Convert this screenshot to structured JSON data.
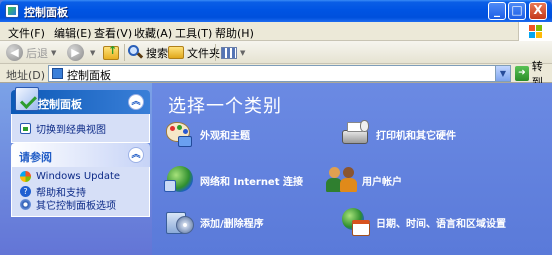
{
  "window": {
    "title": "控制面板",
    "buttons": {
      "minimize": "_",
      "maximize": "□",
      "close": "X"
    }
  },
  "menu": [
    "文件(F)",
    "编辑(E)",
    "查看(V)",
    "收藏(A)",
    "工具(T)",
    "帮助(H)"
  ],
  "toolbar": {
    "back": "后退",
    "search": "搜索",
    "folders": "文件夹"
  },
  "address": {
    "label": "地址(D)",
    "value": "控制面板",
    "go": "转到"
  },
  "left_pane": {
    "control_panel": {
      "title": "控制面板",
      "link": "切换到经典视图"
    },
    "see_also": {
      "title": "请参阅",
      "links": [
        "Windows Update",
        "帮助和支持",
        "其它控制面板选项"
      ]
    }
  },
  "main": {
    "heading": "选择一个类别",
    "categories": [
      {
        "label": "外观和主题",
        "icon": "appearance-themes-icon"
      },
      {
        "label": "打印机和其它硬件",
        "icon": "printers-hardware-icon"
      },
      {
        "label": "网络和 Internet 连接",
        "icon": "network-internet-icon"
      },
      {
        "label": "用户帐户",
        "icon": "user-accounts-icon"
      },
      {
        "label": "添加/删除程序",
        "icon": "add-remove-programs-icon"
      },
      {
        "label": "日期、时间、语言和区域设置",
        "icon": "date-time-language-icon"
      }
    ]
  },
  "colors": {
    "titlebar": "#0054e3",
    "panel_bg": "#d6dff7",
    "main_bg": "#6b8ae3",
    "link": "#0c2a87"
  }
}
